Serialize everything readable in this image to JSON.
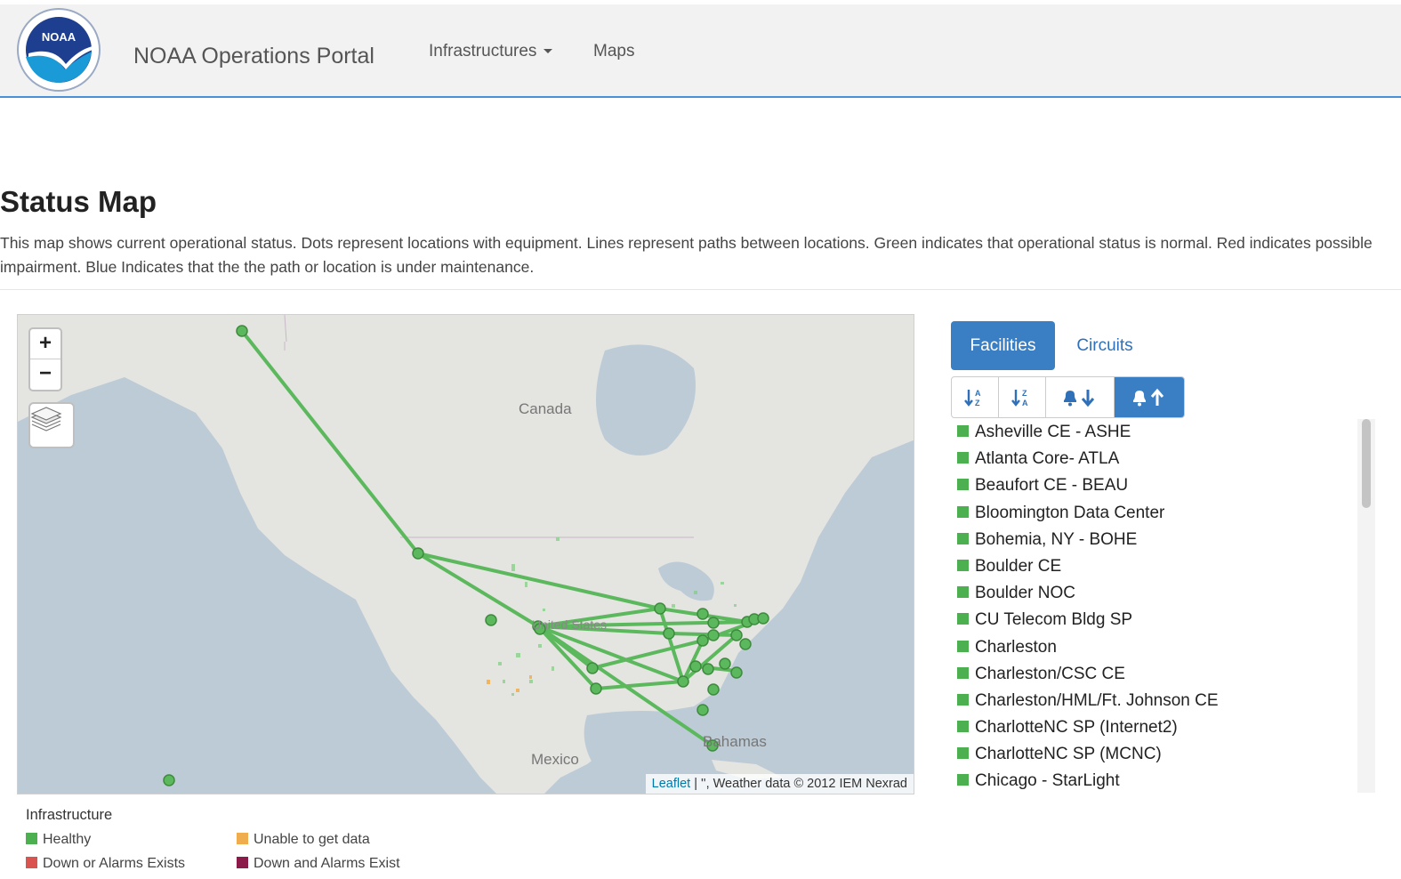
{
  "navbar": {
    "brand": "NOAA Operations Portal",
    "logo_text": "NOAA",
    "items": [
      {
        "label": "Infrastructures"
      },
      {
        "label": "Maps"
      }
    ]
  },
  "page": {
    "title": "Status Map",
    "description": "This map shows current operational status. Dots represent locations with equipment. Lines represent paths between locations. Green indicates that operational status is normal. Red indicates possible impairment. Blue Indicates that the the path or location is under maintenance."
  },
  "map": {
    "zoom_in": "+",
    "zoom_out": "−",
    "labels": {
      "canada": "Canada",
      "united_states": "United States",
      "mexico": "Mexico",
      "bahamas": "Bahamas"
    },
    "attribution_link": "Leaflet",
    "attribution_text": " | '', Weather data © 2012 IEM Nexrad",
    "colors": {
      "path": "#5cb85c",
      "node": "#5cb85c",
      "water": "#bccbd6",
      "land": "#e4e4e0"
    }
  },
  "legend": {
    "title": "Infrastructure",
    "items": [
      {
        "label": "Healthy",
        "color": "#4caf50"
      },
      {
        "label": "Unable to get data",
        "color": "#f0ad4e"
      },
      {
        "label": "Down or Alarms Exists",
        "color": "#d9534f"
      },
      {
        "label": "Down and Alarms Exist",
        "color": "#8b1a4a"
      }
    ]
  },
  "sidebar": {
    "tabs": [
      {
        "label": "Facilities",
        "active": true
      },
      {
        "label": "Circuits",
        "active": false
      }
    ],
    "sort_buttons": [
      {
        "icon": "sort-alpha-asc-icon"
      },
      {
        "icon": "sort-alpha-desc-icon"
      },
      {
        "icon": "bell-arrow-down-icon"
      },
      {
        "icon": "bell-arrow-up-icon",
        "active": true
      }
    ],
    "facilities": [
      "Asheville CE - ASHE",
      "Atlanta Core- ATLA",
      "Beaufort CE - BEAU",
      "Bloomington Data Center",
      "Bohemia, NY - BOHE",
      "Boulder CE",
      "Boulder NOC",
      "CU Telecom Bldg SP",
      "Charleston",
      "Charleston/CSC CE",
      "Charleston/HML/Ft. Johnson CE",
      "CharlotteNC SP (Internet2)",
      "CharlotteNC SP (MCNC)",
      "Chicago - StarLight"
    ],
    "status_color": "#4caf50"
  }
}
